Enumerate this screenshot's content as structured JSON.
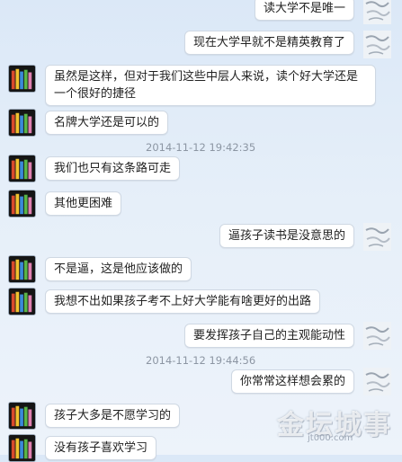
{
  "messages": [
    {
      "side": "right",
      "text": "读大学不是唯一"
    },
    {
      "side": "right",
      "text": "现在大学早就不是精英教育了"
    },
    {
      "side": "left",
      "text": "虽然是这样，但对于我们这些中层人来说，读个好大学还是一个很好的捷径"
    },
    {
      "side": "left",
      "text": "名牌大学还是可以的"
    },
    {
      "type": "timestamp",
      "text": "2014-11-12 19:42:35"
    },
    {
      "side": "left",
      "text": "我们也只有这条路可走"
    },
    {
      "side": "left",
      "text": "其他更困难"
    },
    {
      "side": "right",
      "text": "逼孩子读书是没意思的"
    },
    {
      "side": "left",
      "text": "不是逼，这是他应该做的"
    },
    {
      "side": "left",
      "text": "我想不出如果孩子考不上好大学能有啥更好的出路"
    },
    {
      "side": "right",
      "text": "要发挥孩子自己的主观能动性"
    },
    {
      "type": "timestamp",
      "text": "2014-11-12 19:44:56"
    },
    {
      "side": "right",
      "text": "你常常这样想会累的"
    },
    {
      "side": "left",
      "text": "孩子大多是不愿学习的"
    },
    {
      "side": "left",
      "text": "没有孩子喜欢学习"
    }
  ],
  "watermark": {
    "logo_text": "金坛城事",
    "url_text": "jt000.com"
  }
}
